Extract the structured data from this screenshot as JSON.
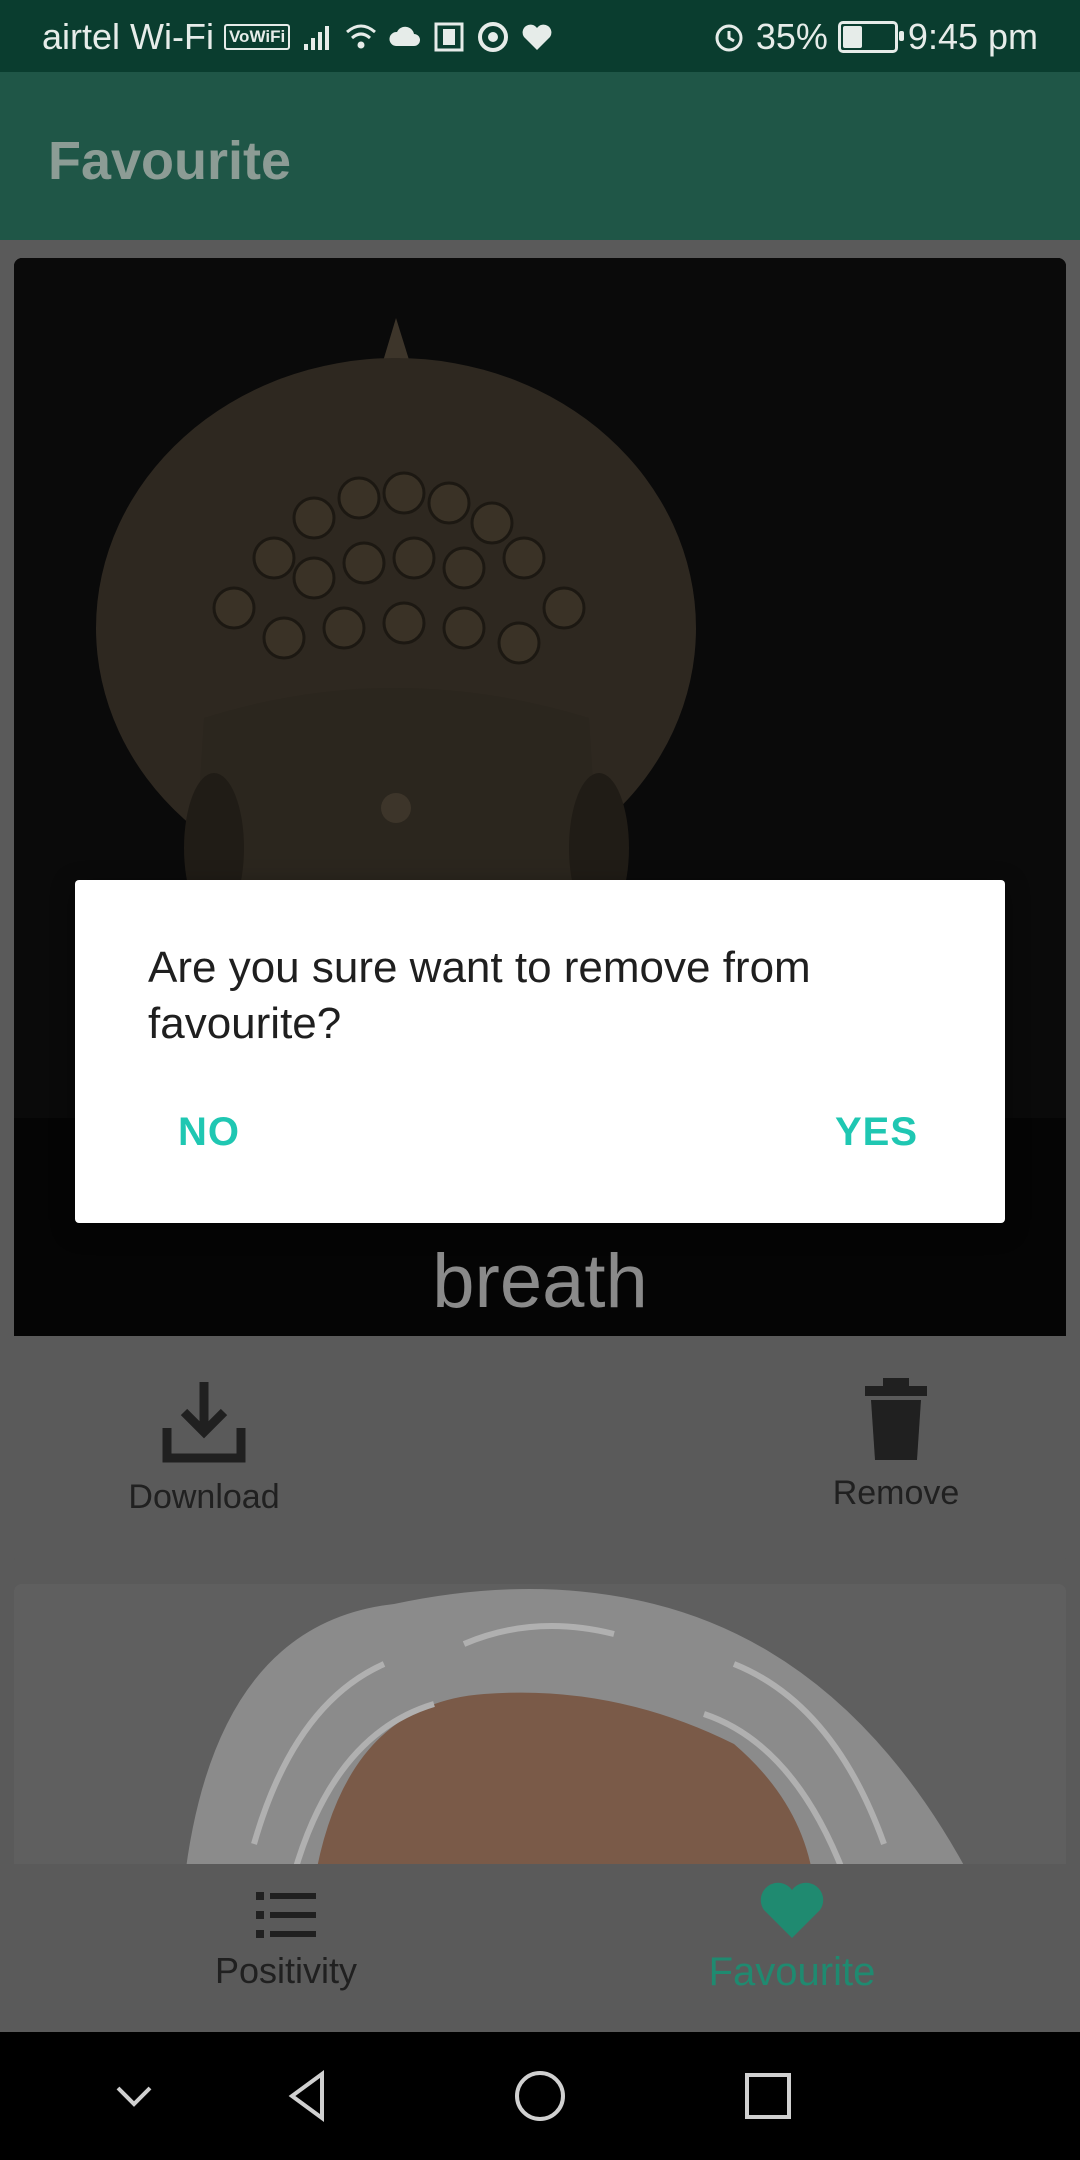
{
  "status_bar": {
    "carrier": "airtel Wi-Fi",
    "vowifi_badge": "VoWiFi",
    "battery": "35%",
    "battery_level": 0.35,
    "time": "9:45 pm",
    "icons": [
      "signal-icon",
      "wifi-icon",
      "cloud-icon",
      "notification-icon",
      "chrome-icon",
      "heart-check-icon",
      "alarm-icon",
      "battery-icon"
    ]
  },
  "app_bar": {
    "title": "Favourite"
  },
  "cards": [
    {
      "quote_word": "breath",
      "actions": {
        "download_label": "Download",
        "remove_label": "Remove"
      }
    }
  ],
  "dialog": {
    "message": "Are you sure want to remove from favourite?",
    "no_label": "NO",
    "yes_label": "YES"
  },
  "bottom_nav": {
    "items": [
      {
        "label": "Positivity",
        "icon": "list-icon",
        "active": false
      },
      {
        "label": "Favourite",
        "icon": "heart-icon",
        "active": true
      }
    ],
    "active_color": "#1f8a70",
    "inactive_color": "#202020"
  },
  "colors": {
    "status_bar": "#0a3d2f",
    "app_bar": "#1f5647",
    "accent": "#1fc7b2"
  }
}
